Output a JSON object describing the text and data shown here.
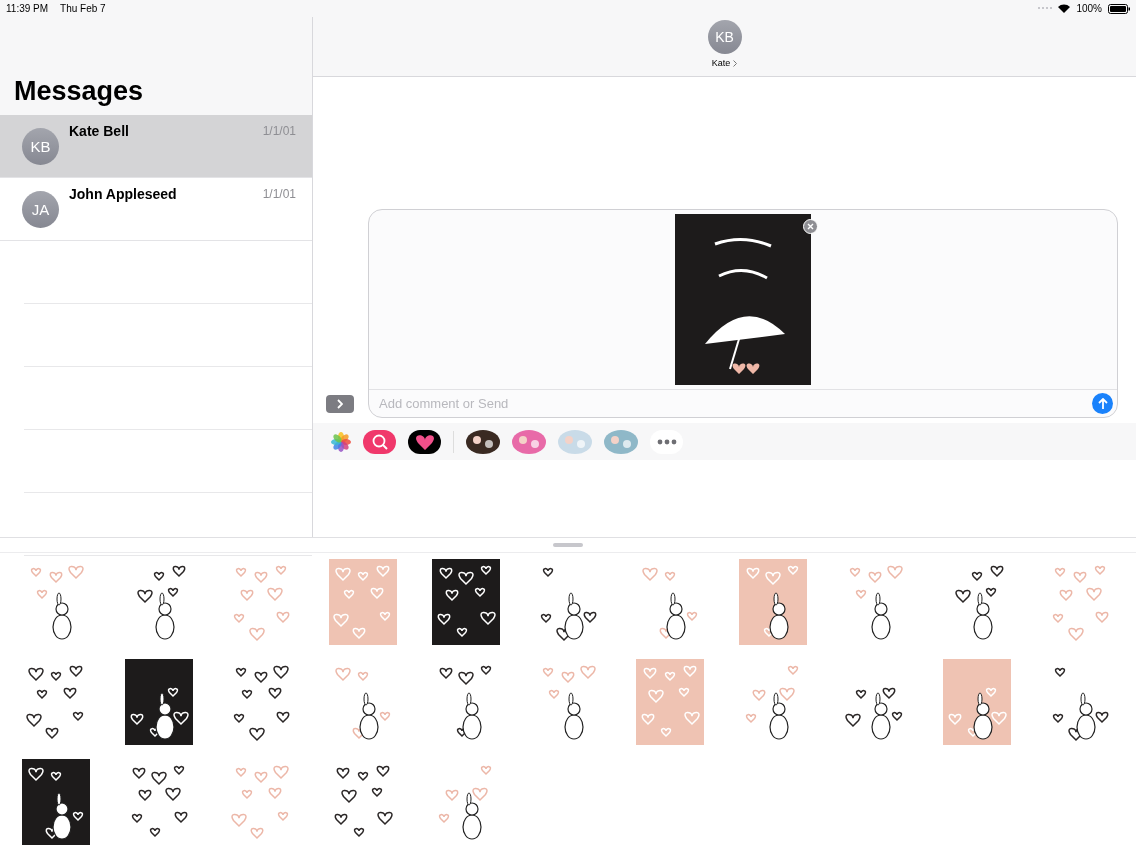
{
  "status_bar": {
    "time": "11:39 PM",
    "date": "Thu Feb 7",
    "battery": "100%"
  },
  "sidebar": {
    "title": "Messages",
    "conversations": [
      {
        "initials": "KB",
        "name": "Kate Bell",
        "date": "1/1/01",
        "selected": true
      },
      {
        "initials": "JA",
        "name": "John Appleseed",
        "date": "1/1/01",
        "selected": false
      }
    ]
  },
  "conversation": {
    "initials": "KB",
    "name": "Kate"
  },
  "compose": {
    "placeholder": "Add comment or Send"
  },
  "app_strip": [
    {
      "kind": "photos"
    },
    {
      "kind": "search"
    },
    {
      "kind": "heart"
    },
    {
      "kind": "sticker"
    },
    {
      "kind": "sticker"
    },
    {
      "kind": "sticker"
    },
    {
      "kind": "sticker"
    },
    {
      "kind": "more"
    }
  ]
}
